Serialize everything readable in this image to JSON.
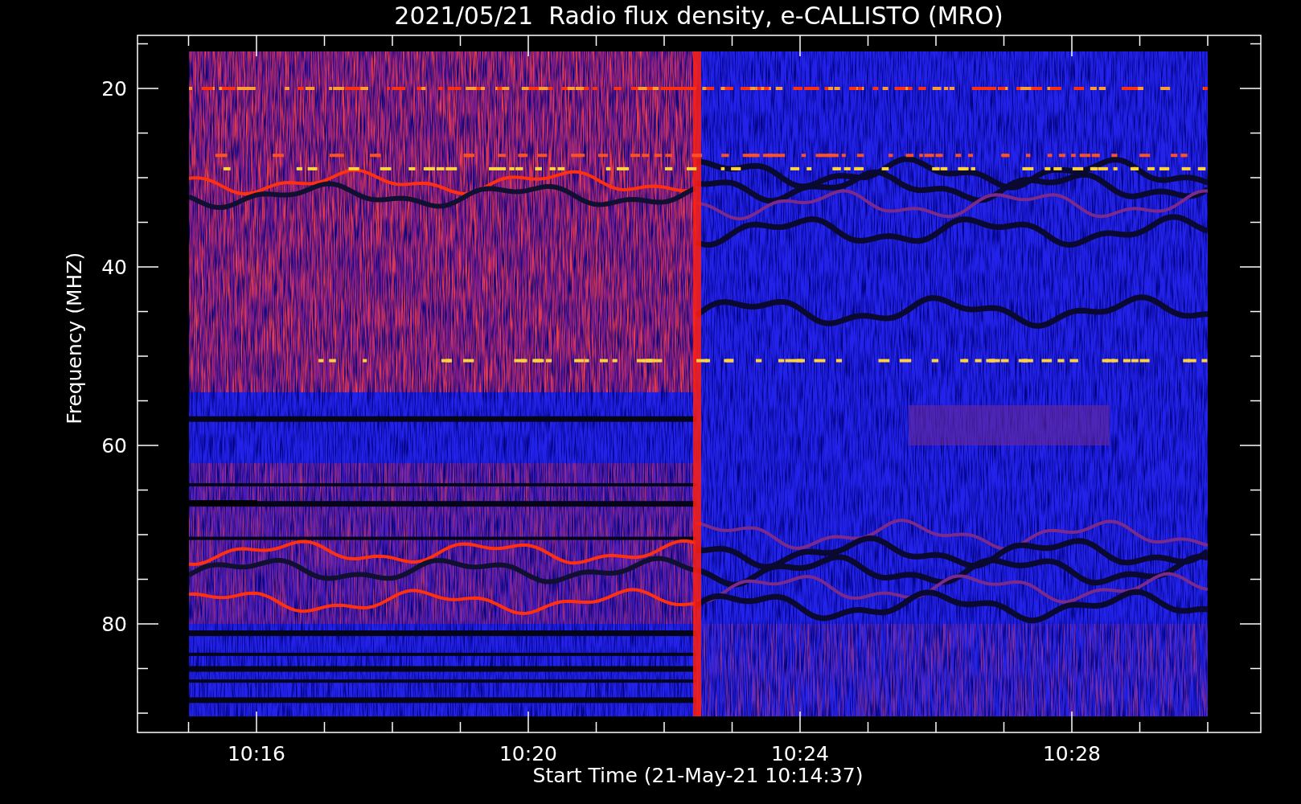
{
  "title": "2021/05/21  Radio flux density, e-CALLISTO (MRO)",
  "y_axis": {
    "label": "Frequency (MHZ)",
    "ticks": [
      "20",
      "40",
      "60",
      "80"
    ]
  },
  "x_axis": {
    "label": "Start Time (21-May-21 10:14:37)",
    "ticks": [
      "10:16",
      "10:20",
      "10:24",
      "10:28"
    ]
  }
}
